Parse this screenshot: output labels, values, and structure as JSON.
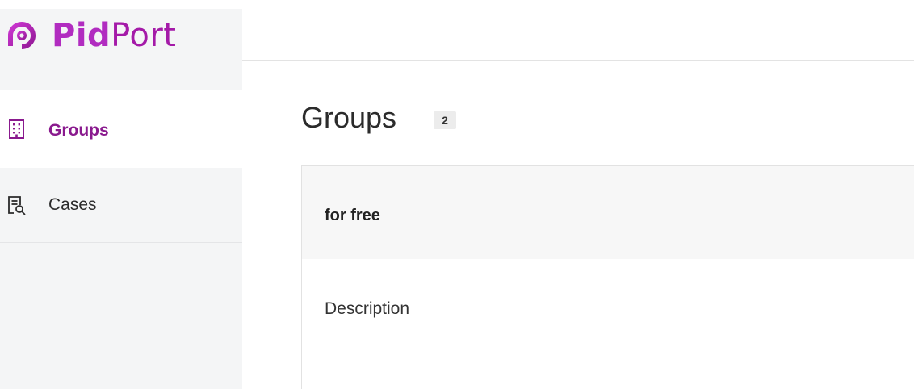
{
  "brand": {
    "name_bold": "Pid",
    "name_light": "Port",
    "logo_icon": "pidport-logo-icon",
    "colors": {
      "primary": "#b12cc0",
      "dark": "#8a1a8e"
    }
  },
  "sidebar": {
    "items": [
      {
        "label": "Groups",
        "icon": "building-icon",
        "active": true
      },
      {
        "label": "Cases",
        "icon": "document-search-icon",
        "active": false
      }
    ]
  },
  "main": {
    "title": "Groups",
    "count": "2",
    "groups": [
      {
        "name": "for free",
        "description": "Description"
      }
    ]
  }
}
